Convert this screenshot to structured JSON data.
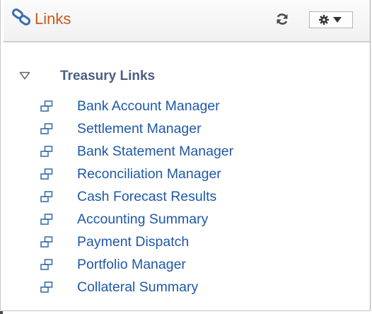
{
  "header": {
    "title": "Links",
    "icon": "chain-link-icon",
    "refresh_icon": "refresh-icon",
    "actions_icon": "gear-icon",
    "actions_caret_icon": "caret-down-icon"
  },
  "section": {
    "title": "Treasury Links",
    "toggle_icon": "triangle-down-icon",
    "expanded": true
  },
  "links": [
    {
      "label": "Bank Account Manager",
      "icon": "link-node-icon"
    },
    {
      "label": "Settlement Manager",
      "icon": "link-node-icon"
    },
    {
      "label": "Bank Statement Manager",
      "icon": "link-node-icon"
    },
    {
      "label": "Reconciliation Manager",
      "icon": "link-node-icon"
    },
    {
      "label": "Cash Forecast Results",
      "icon": "link-node-icon"
    },
    {
      "label": "Accounting Summary",
      "icon": "link-node-icon"
    },
    {
      "label": "Payment Dispatch",
      "icon": "link-node-icon"
    },
    {
      "label": "Portfolio Manager",
      "icon": "link-node-icon"
    },
    {
      "label": "Collateral Summary",
      "icon": "link-node-icon"
    }
  ],
  "colors": {
    "title": "#c95a17",
    "section_title": "#4b5f84",
    "link": "#1e58a8",
    "icon_blue": "#3a6fb0"
  }
}
